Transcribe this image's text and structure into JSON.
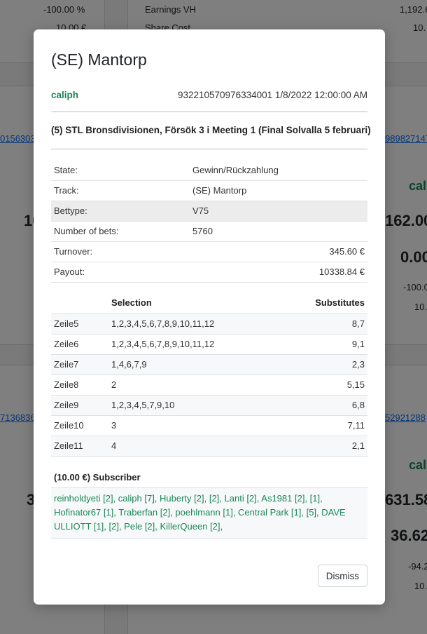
{
  "background": {
    "top_left_percent": "-100.00 %",
    "top_left_amount": "10.00 €",
    "earnings_label": "Earnings VH",
    "earnings_value": "1,192.6",
    "share_cost_label": "Share Cost",
    "share_cost_value": "10.",
    "link_left_1": "0156303",
    "link_right_1": "989827147",
    "user_right_1": "cal",
    "big_left_1": "10",
    "big_right_1": "162.00",
    "zero_right_1": "0.00",
    "pct_right_1": "-100.0",
    "amt_right_1": "10.",
    "link_left_2": "7136836",
    "link_right_2": "52921288",
    "user_right_2": "cal",
    "big_left_2": "3",
    "big_right_2": "631.58",
    "zero_right_2": "36.62",
    "pct_right_2": "-94.2",
    "amt_right_2": "10."
  },
  "modal": {
    "title": "(SE) Mantorp",
    "user": "caliph",
    "meta": "932210570976334001 1/8/2022 12:00:00 AM",
    "race": "(5) STL Bronsdivisionen, Försök 3 i Meeting 1 (Final Solvalla 5 februari)",
    "info": [
      {
        "label": "State:",
        "value": "Gewinn/Rückzahlung"
      },
      {
        "label": "Track:",
        "value": "(SE) Mantorp"
      },
      {
        "label": "Bettype:",
        "value": "V75"
      },
      {
        "label": "Number of bets:",
        "value": "5760"
      },
      {
        "label": "Turnover:",
        "value": "345.60 €"
      },
      {
        "label": "Payout:",
        "value": "10338.84 €"
      }
    ],
    "selection_headers": {
      "col1": "",
      "col2": "Selection",
      "col3": "Substitutes"
    },
    "selections": [
      {
        "row": "Zeile5",
        "selection": "1,2,3,4,5,6,7,8,9,10,11,12",
        "substitutes": "8,7"
      },
      {
        "row": "Zeile6",
        "selection": "1,2,3,4,5,6,7,8,9,10,11,12",
        "substitutes": "9,1"
      },
      {
        "row": "Zeile7",
        "selection": "1,4,6,7,9",
        "substitutes": "2,3"
      },
      {
        "row": "Zeile8",
        "selection": "2",
        "substitutes": "5,15"
      },
      {
        "row": "Zeile9",
        "selection": "1,2,3,4,5,7,9,10",
        "substitutes": "6,8"
      },
      {
        "row": "Zeile10",
        "selection": "3",
        "substitutes": "7,11"
      },
      {
        "row": "Zeile11",
        "selection": "4",
        "substitutes": "2,1"
      }
    ],
    "subscriber_title": "(10.00 €) Subscriber",
    "subscribers": "reinholdyeti [2], caliph [7], Huberty [2], [2], Lanti [2], As1981 [2], [1], Hofinator67 [1], Traberfan [2], poehlmann [1], Central Park [1], [5], DAVE ULLIOTT [1], [2], Pele [2], KillerQueen [2],",
    "dismiss_label": "Dismiss"
  },
  "colors": {
    "accent_green": "#198754",
    "link_blue": "#0d6efd"
  }
}
